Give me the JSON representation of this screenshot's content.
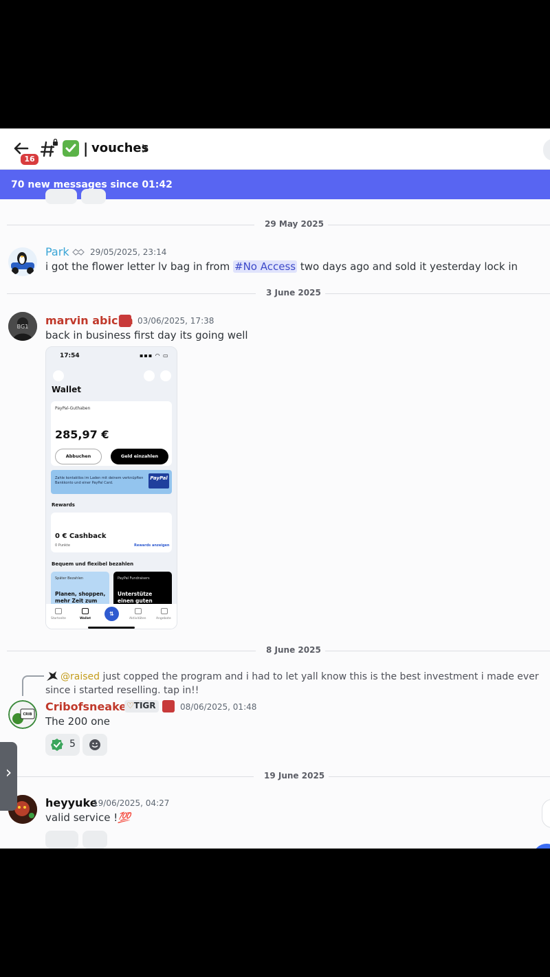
{
  "header": {
    "back_badge": "16",
    "channel_bar": "|",
    "channel_name": "vouches"
  },
  "banner": {
    "text": "70 new messages since 01:42"
  },
  "dividers": [
    "29 May 2025",
    "3 June 2025",
    "8 June 2025",
    "19 June 2025"
  ],
  "messages": [
    {
      "username": "Park",
      "color": "#3aa5d6",
      "timestamp": "29/05/2025, 23:14",
      "text_before": "i got the flower letter lv bag in from ",
      "channel_mention": "No Access",
      "text_after": " two days ago and sold it yesterday lock in"
    },
    {
      "username": "marvin abicim",
      "color": "#c0392b",
      "timestamp": "03/06/2025, 17:38",
      "text": "back in business first day its going well",
      "attachment": {
        "time": "17:54",
        "title": "Wallet",
        "balance_label": "PayPal-Guthaben",
        "balance": "285,97 €",
        "btn_withdraw": "Abbuchen",
        "btn_deposit": "Geld einzahlen",
        "promo_text": "Zahle kontaktlos im Laden mit deinem verknüpften Bankkonto und einer PayPal Card.",
        "promo_brand": "PayPal",
        "rewards_title": "Rewards",
        "cashback": "0 € Cashback",
        "points": "0 Punkte",
        "rewards_link": "Rewards anzeigen",
        "section_title": "Bequem und flexibel bezahlen",
        "card_left_label": "Später Bezahlen",
        "card_left_text": "Planen, shoppen, mehr Zeit zum",
        "card_right_label": "PayPal Fundraisers",
        "card_right_text": "Unterstütze einen guten Zweck",
        "tabs": [
          "Startseite",
          "Wallet",
          "Aktivitäten",
          "Angebote"
        ]
      }
    },
    {
      "reply_mention": "@raised",
      "reply_text": " just copped the program and i had to let yall know this is the best investment i made ever since i started reselling. tap in!!",
      "username": "Cribofsneakers",
      "color": "#c0392b",
      "tag": "TIGR",
      "timestamp": "08/06/2025, 01:48",
      "text": "The 200 one",
      "reaction_count": "5"
    },
    {
      "username": "heyyuke",
      "color": "#111111",
      "timestamp": "19/06/2025, 04:27",
      "text": "valid service !",
      "emoji": "💯"
    }
  ],
  "colors": {
    "accent": "#5865f2",
    "badge_red": "#d83c3e",
    "check_green": "#5bb348"
  }
}
